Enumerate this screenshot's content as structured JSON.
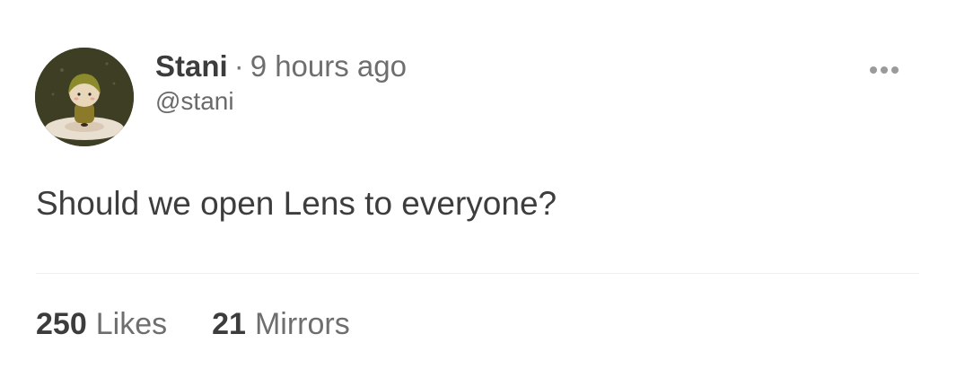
{
  "post": {
    "author": {
      "display_name": "Stani",
      "handle": "@stani",
      "avatar_icon": "avatar-illustration-icon"
    },
    "separator": "·",
    "timestamp": "9 hours ago",
    "menu_icon": "more-horizontal-icon",
    "content": "Should we open Lens to everyone?",
    "stats": {
      "likes": {
        "count": "250",
        "label": "Likes"
      },
      "mirrors": {
        "count": "21",
        "label": "Mirrors"
      }
    }
  }
}
